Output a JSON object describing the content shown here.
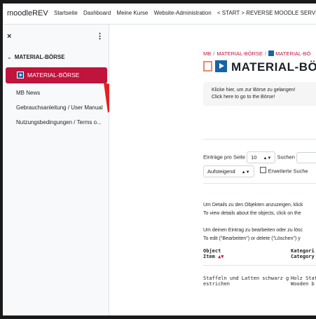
{
  "navbar": {
    "brand": "moodleREV",
    "links": [
      "Startseite",
      "Dashboard",
      "Meine Kurse",
      "Website-Administration",
      "< START > REVERSE MOODLE SERVER ⌄"
    ]
  },
  "drawer": {
    "close_icon": "×",
    "menu_icon": "⋮",
    "section_chevron": "⌄",
    "section_title": "MATERIAL-BÖRSE",
    "active_item": "MATERIAL-BÖRSE",
    "items": [
      "MB News",
      "Gebrauchsanleitung / User Manual",
      "Nutzungsbedingungen / Terms o..."
    ]
  },
  "main": {
    "breadcrumb": [
      "MB",
      "MATERIAL-BÖRSE",
      "MATERIAL-BÖ"
    ],
    "breadcrumb_sep": "/",
    "title": "MATERIAL-BÖR",
    "info": {
      "line1": "Klicke hier, um zur Börse zu gelangen!",
      "line2": "Click here to go to the Börse!"
    },
    "entries_label": "Einträge pro Seite",
    "entries_value": "10",
    "search_label": "Suchen",
    "sort_value": "Aufsteigend",
    "advanced_search": "Erweiterte Suche",
    "details_de": "Um Details zu den Objekten anzuzeigen, klick",
    "details_en": "To view details about the objects, click on the",
    "edit_de": "Um deinen Eintrag zu bearbeiten oder zu lösc",
    "edit_en": "To edit (\"Bearbeiten\") or delete (\"Löschen\") y",
    "table": {
      "col1_line1": "Object",
      "col1_line2": "Item",
      "sort_arrows": "▲▼",
      "col2_line1": "Kategori",
      "col2_line2": "Category",
      "row1_col1_line1": "Staffeln und Latten schwarz g",
      "row1_col1_line2": "estrichen",
      "row1_col2_line1": "Holz Staff",
      "row1_col2_line2": "Wooden b"
    }
  },
  "colors": {
    "accent": "#c0143c",
    "brand_blue": "#1565a6"
  }
}
